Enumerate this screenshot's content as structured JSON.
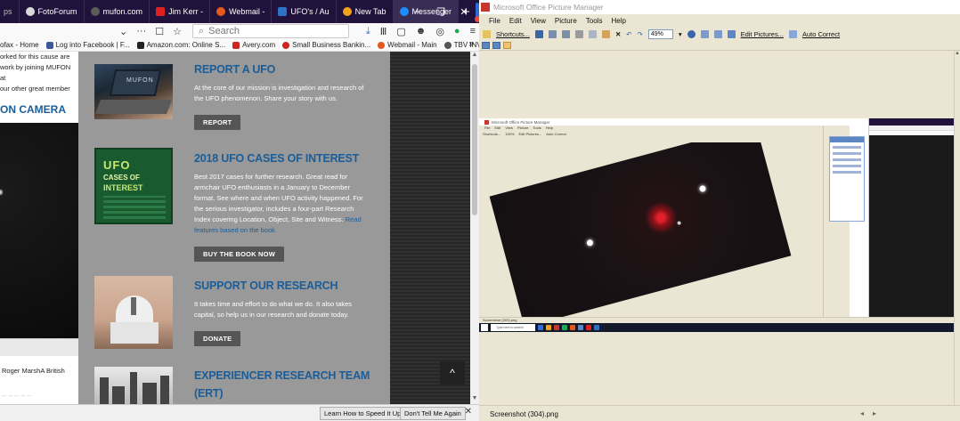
{
  "browser": {
    "tabs": [
      {
        "label": "FotoForum",
        "color": "#d9d9d9"
      },
      {
        "label": "mufon.com",
        "color": "#5b5b5b"
      },
      {
        "label": "Jim Kerr -",
        "color": "#e02020"
      },
      {
        "label": "Webmail -",
        "color": "#e45a1c"
      },
      {
        "label": "UFO's / Au",
        "color": "#2c72c7"
      },
      {
        "label": "New Tab",
        "color": "#f3a21b"
      },
      {
        "label": "Messenger",
        "color": "#1c8dfc"
      }
    ],
    "new_tab_label": "+",
    "window_controls": {
      "minimize": "–",
      "maximize": "❐",
      "close": "✕"
    },
    "search_placeholder": "Search",
    "url_controls": [
      "⌄",
      "···",
      "☐",
      "☆"
    ],
    "nav_icons": [
      "⤓",
      "Ⅲ",
      "▢",
      "☻",
      "◎",
      "●",
      "≡"
    ],
    "bookmarks": [
      {
        "label": "ofax - Home",
        "color": null
      },
      {
        "label": "Log into Facebook | F...",
        "color": "#3b5998"
      },
      {
        "label": "Amazon.com: Online S...",
        "color": "#222222"
      },
      {
        "label": "Avery.com",
        "color": "#d0241f"
      },
      {
        "label": "Small Business Bankin...",
        "color": "#d0241f"
      },
      {
        "label": "Webmail - Main",
        "color": "#e45a1c"
      },
      {
        "label": "TBV INV.",
        "color": "#555555"
      }
    ],
    "bookmarks_more": "»"
  },
  "page": {
    "left_text": [
      "orked for this cause are",
      "work by joining MUFON at",
      "our other great member"
    ],
    "left_heading": "ON CAMERA",
    "left_caption": "Roger MarshA British",
    "left_caption2": "-- -- -- -- --",
    "cards": [
      {
        "title": "REPORT A UFO",
        "body": "At the core of our mission is investigation and research of the UFO phenomenon. Share your story with us.",
        "link": "",
        "button": "REPORT"
      },
      {
        "title": "2018 UFO CASES OF INTEREST",
        "body": "Best 2017 cases for further research. Great read for armchair UFO enthusiasts in a January to December format. See where and when UFO activity happened. For the serious investigator, includes a four-part Research Index covering Location, Object, Site and Witness.",
        "link": "Read features based on the book.",
        "button": "BUY THE BOOK NOW"
      },
      {
        "title": "SUPPORT OUR RESEARCH",
        "body": "It takes time and effort to do what we do. It also takes capital, so help us in our research and donate today.",
        "link": "",
        "button": "DONATE"
      },
      {
        "title": "EXPERIENCER RESEARCH TEAM",
        "title2": "(ERT)",
        "body": "",
        "link": "",
        "button": ""
      }
    ],
    "book_cover": {
      "line1": "UFO",
      "line2": "CASES OF",
      "line3": "INTEREST"
    },
    "laptop_brand": "MUFON",
    "to_top": "^"
  },
  "notification": {
    "learn": "Learn How to Speed It Up",
    "dont": "Don't Tell Me Again",
    "close": "✕"
  },
  "opm": {
    "title": "Microsoft Office Picture Manager",
    "menu": [
      "File",
      "Edit",
      "View",
      "Picture",
      "Tools",
      "Help"
    ],
    "toolbar": {
      "shortcuts": "Shortcuts...",
      "zoom": "49%",
      "edit_pictures": "Edit Pictures...",
      "auto_correct": "Auto Correct"
    },
    "status_filename": "Screenshot (304).png",
    "nav": [
      "◂",
      "▸"
    ],
    "inner": {
      "title": "Microsoft Office Picture Manager",
      "menu": [
        "File",
        "Edit",
        "View",
        "Picture",
        "Tools",
        "Help"
      ],
      "toolbar": [
        "Shortcuts...",
        "100%",
        "Edit Pictures...",
        "Auto Correct"
      ],
      "status": "Screenshot (303).png",
      "search": "Type here to search"
    }
  }
}
